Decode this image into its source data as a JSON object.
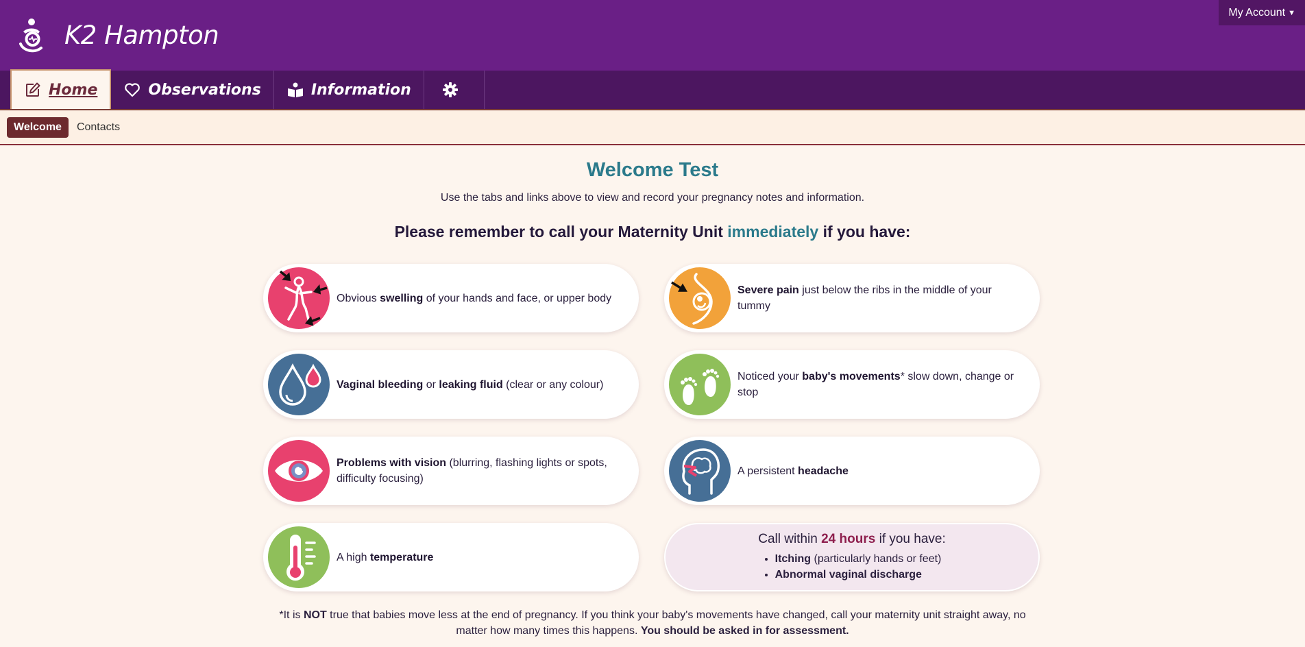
{
  "header": {
    "title": "K2 Hampton",
    "account_label": "My Account",
    "logo_icon": "mother-baby-heart-logo"
  },
  "nav": {
    "tabs": [
      {
        "label": "Home",
        "icon": "edit-icon",
        "active": true
      },
      {
        "label": "Observations",
        "icon": "heart-outline-icon",
        "active": false
      },
      {
        "label": "Information",
        "icon": "reading-person-icon",
        "active": false
      },
      {
        "label": "",
        "icon": "gear-icon",
        "active": false
      }
    ]
  },
  "subnav": {
    "items": [
      {
        "label": "Welcome",
        "active": true
      },
      {
        "label": "Contacts",
        "active": false
      }
    ]
  },
  "main": {
    "title": "Welcome Test",
    "intro": "Use the tabs and links above to view and record your pregnancy notes and information.",
    "remember_pre": "Please remember to call your Maternity Unit ",
    "remember_highlight": "immediately",
    "remember_post": " if you have:",
    "symptoms": [
      {
        "icon": "swelling-icon",
        "color": "#e8416e",
        "pre": "Obvious ",
        "bold": "swelling",
        "mid": "",
        "bold2": "",
        "post": " of your hands and face, or upper body"
      },
      {
        "icon": "tummy-pain-icon",
        "color": "#f2a23a",
        "pre": "",
        "bold": "Severe pain",
        "mid": "",
        "bold2": "",
        "post": " just below the ribs in the middle of your tummy"
      },
      {
        "icon": "drops-icon",
        "color": "#466f96",
        "pre": "",
        "bold": "Vaginal bleeding",
        "mid": " or ",
        "bold2": "leaking fluid",
        "post": " (clear or any colour)"
      },
      {
        "icon": "baby-feet-icon",
        "color": "#8fbf5a",
        "pre": "Noticed your ",
        "bold": "baby's movements",
        "mid": "",
        "bold2": "",
        "post": "* slow down, change or stop"
      },
      {
        "icon": "eye-icon",
        "color": "#e8416e",
        "pre": "",
        "bold": "Problems with vision",
        "mid": "",
        "bold2": "",
        "post": " (blurring, flashing lights or spots, difficulty focusing)"
      },
      {
        "icon": "headache-icon",
        "color": "#466f96",
        "pre": "A persistent ",
        "bold": "headache",
        "mid": "",
        "bold2": "",
        "post": ""
      },
      {
        "icon": "thermometer-icon",
        "color": "#8fbf5a",
        "pre": "A high ",
        "bold": "temperature",
        "mid": "",
        "bold2": "",
        "post": ""
      }
    ],
    "hours": {
      "pre": "Call within ",
      "highlight": "24 hours",
      "post": " if you have:",
      "items": [
        {
          "bold": "Itching",
          "rest": " (particularly hands or feet)"
        },
        {
          "bold": "Abnormal vaginal discharge",
          "rest": ""
        }
      ]
    },
    "footnote": {
      "p1": "*It is ",
      "b1": "NOT",
      "p2": " true that babies move less at the end of pregnancy. If you think your baby's movements have changed, call your maternity unit straight away, no matter how many times this happens. ",
      "b2": "You should be asked in for assessment."
    }
  },
  "colors": {
    "header_bg": "#6a1f86",
    "nav_bg": "#4c1660",
    "accent_teal": "#2b7a8b",
    "page_bg": "#fdf5ee"
  }
}
